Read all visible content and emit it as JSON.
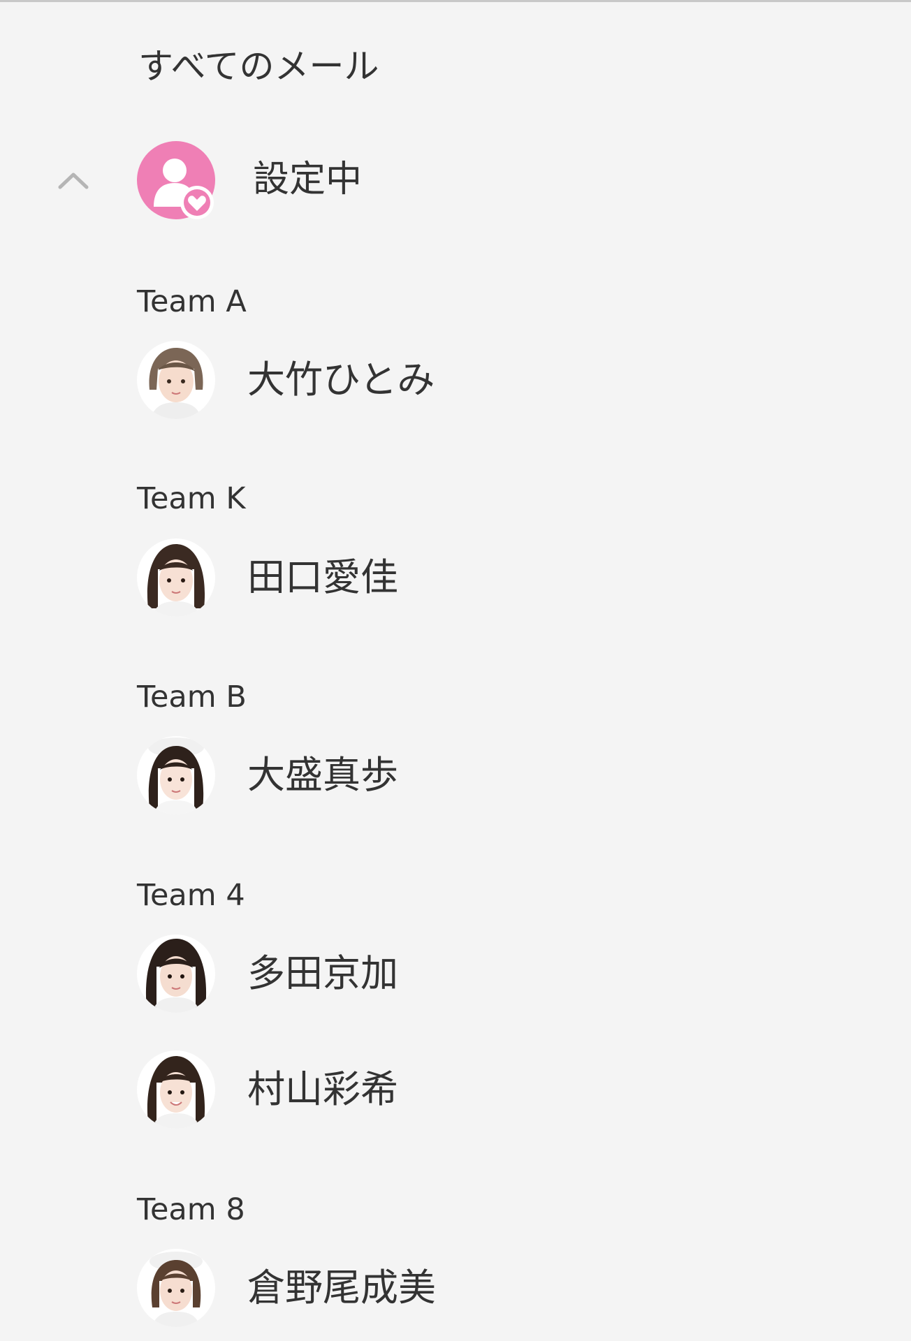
{
  "nav": {
    "all_mail_label": "すべてのメール",
    "subscribed_label": "設定中"
  },
  "colors": {
    "background": "#f4f4f4",
    "accent_pink": "#ef7fb5",
    "text": "#333333",
    "chevron": "#b5b5b5"
  },
  "icons": {
    "collapse": "chevron-up-icon",
    "subscribed": "person-heart-icon"
  },
  "teams": [
    {
      "name": "Team A",
      "members": [
        {
          "name": "大竹ひとみ"
        }
      ]
    },
    {
      "name": "Team K",
      "members": [
        {
          "name": "田口愛佳"
        }
      ]
    },
    {
      "name": "Team B",
      "members": [
        {
          "name": "大盛真歩"
        }
      ]
    },
    {
      "name": "Team 4",
      "members": [
        {
          "name": "多田京加"
        },
        {
          "name": "村山彩希"
        }
      ]
    },
    {
      "name": "Team 8",
      "members": [
        {
          "name": "倉野尾成美"
        }
      ]
    }
  ]
}
